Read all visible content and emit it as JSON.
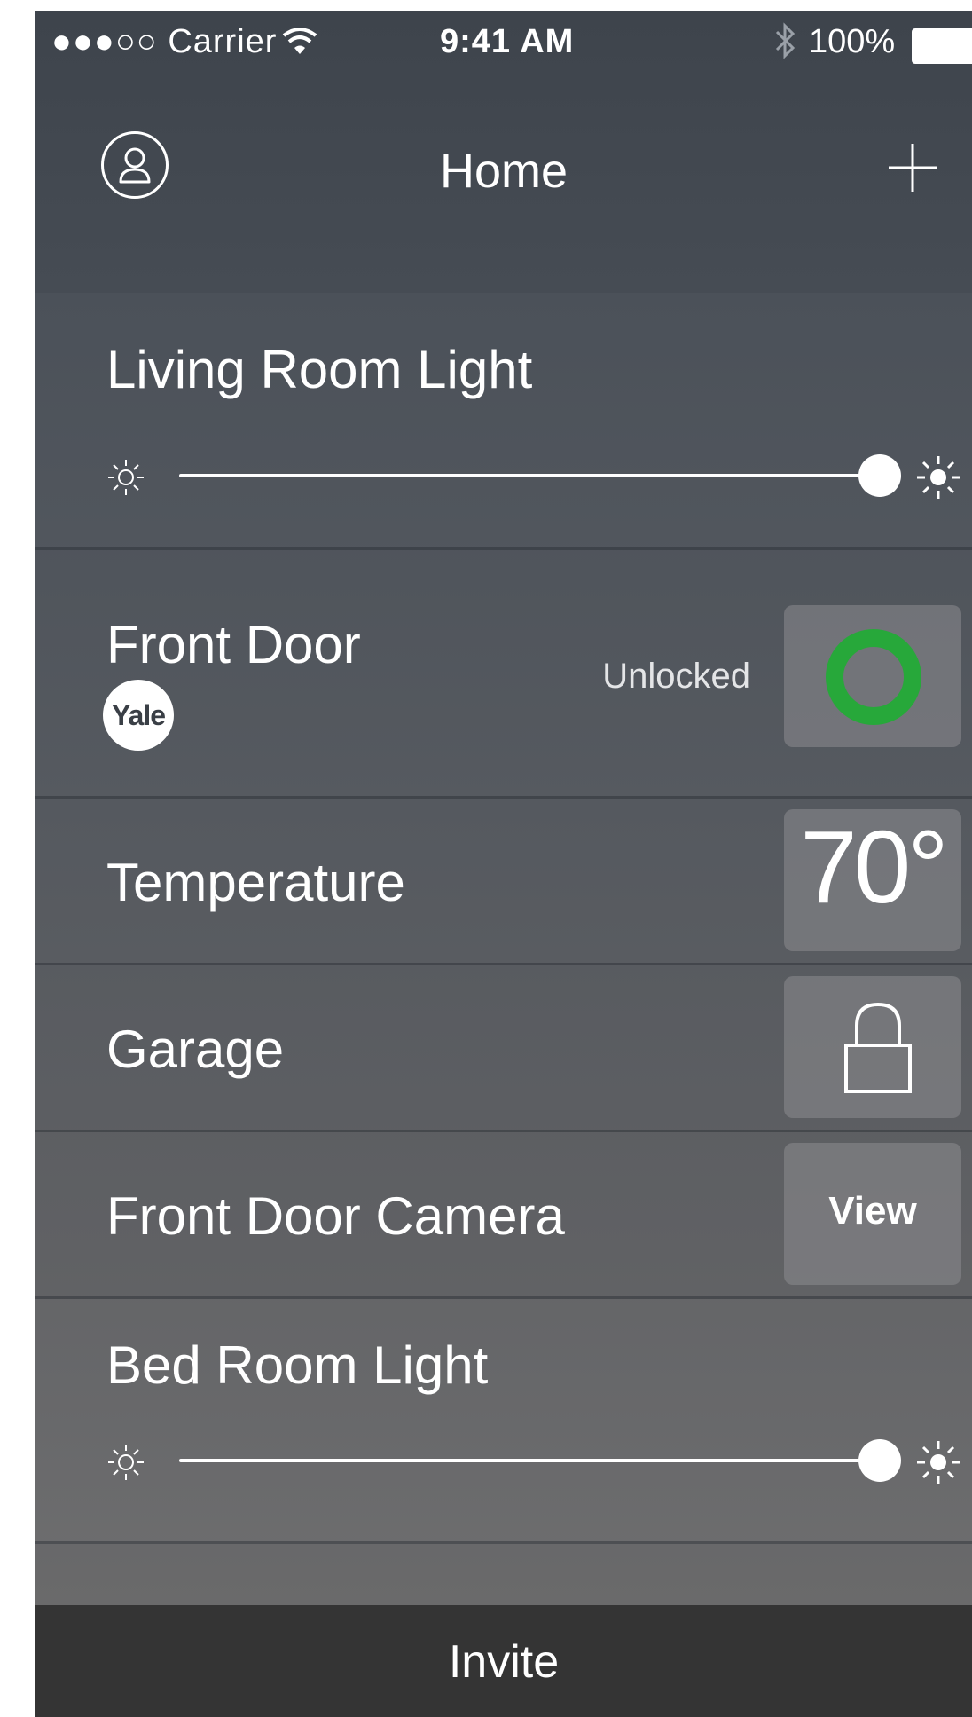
{
  "status_bar": {
    "signal": "●●●○○ Carrier",
    "time": "9:41 AM",
    "battery": "100%"
  },
  "nav": {
    "title": "Home",
    "profile_icon": "person-icon",
    "add_icon": "plus-icon"
  },
  "devices": [
    {
      "title": "Living Room Light",
      "brightness": 1.0
    },
    {
      "title": "Front Door",
      "status": "Unlocked",
      "brand": "Yale",
      "lock_state_color": "#27a83a"
    },
    {
      "title": "Temperature",
      "value": "70°"
    },
    {
      "title": "Garage",
      "icon": "padlock-icon"
    },
    {
      "title": "Front Door Camera",
      "action": "View"
    },
    {
      "title": "Bed Room Light",
      "brightness": 1.0
    }
  ],
  "bottom_bar": {
    "label": "Invite"
  }
}
